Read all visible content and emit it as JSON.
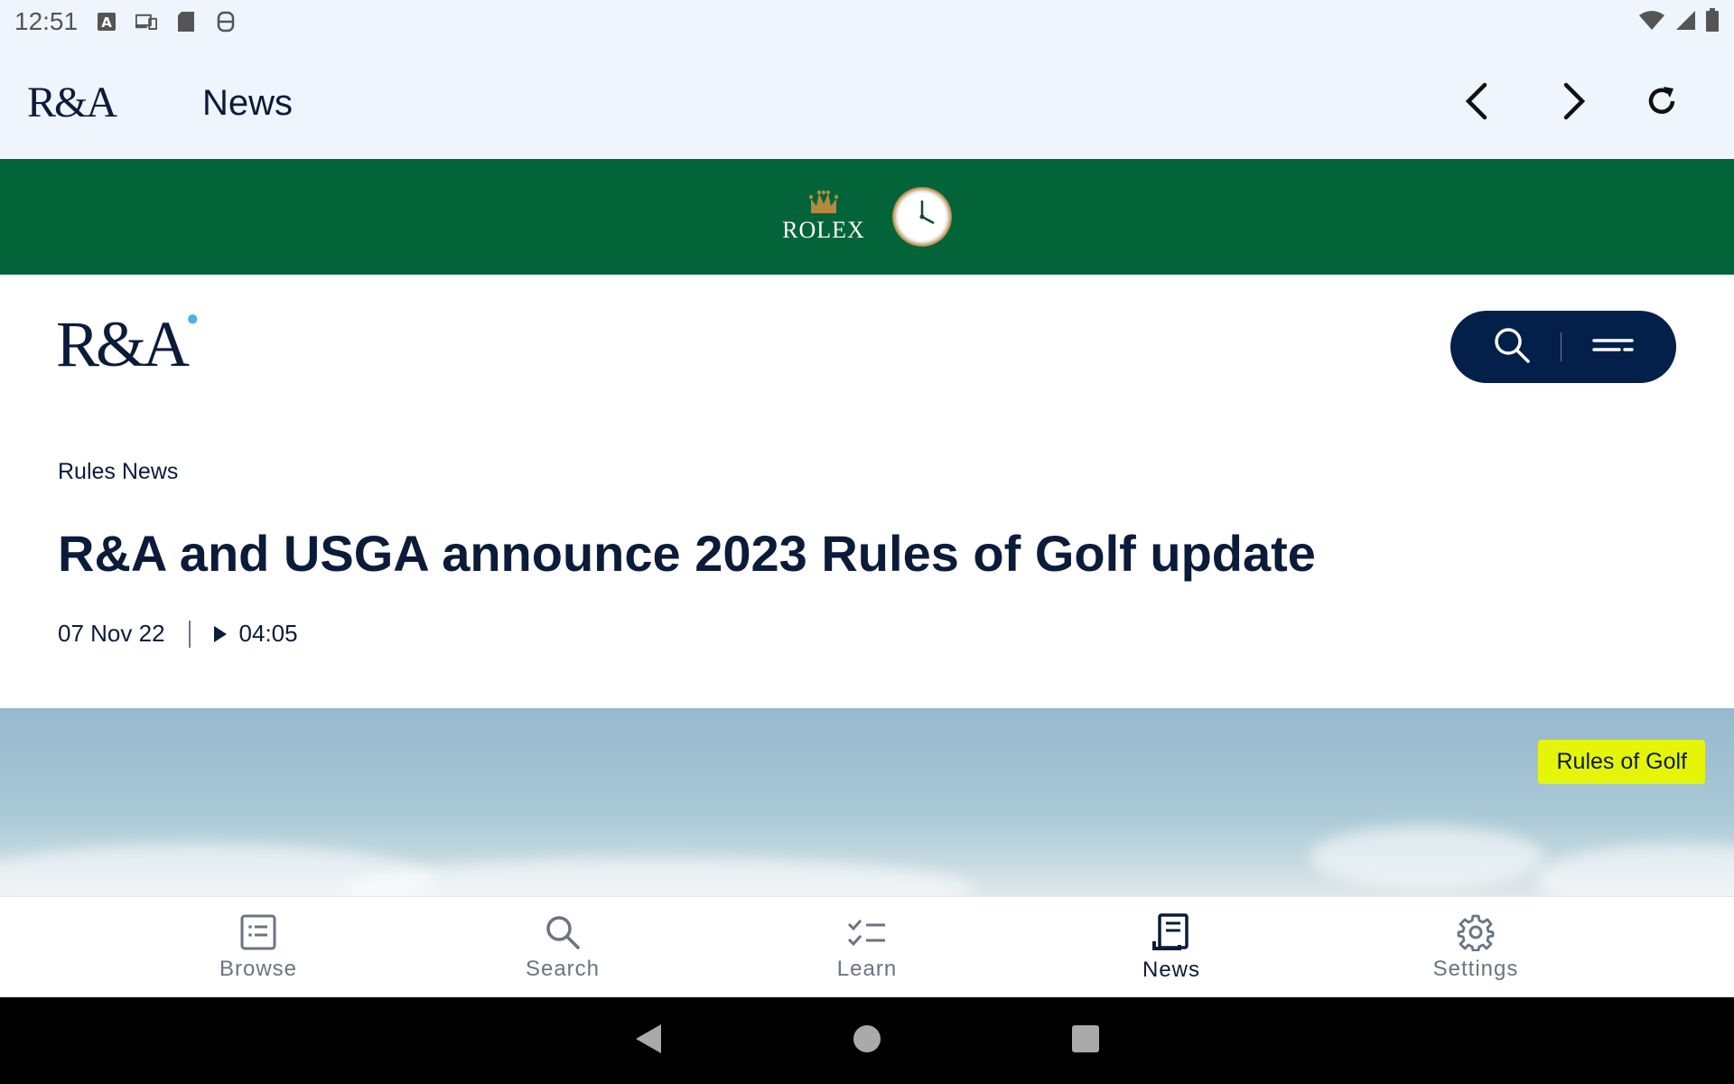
{
  "status_bar": {
    "time": "12:51"
  },
  "app_bar": {
    "logo": "R&A",
    "title": "News"
  },
  "sponsor": {
    "brand": "ROLEX"
  },
  "site": {
    "logo": "R&A"
  },
  "article": {
    "category": "Rules News",
    "headline": "R&A and USGA announce 2023 Rules of Golf update",
    "date": "07 Nov 22",
    "duration": "04:05",
    "image_tag": "Rules of Golf"
  },
  "bottom_nav": {
    "tabs": [
      {
        "label": "Browse",
        "icon": "browse-icon"
      },
      {
        "label": "Search",
        "icon": "search-icon"
      },
      {
        "label": "Learn",
        "icon": "checklist-icon"
      },
      {
        "label": "News",
        "icon": "news-icon",
        "active": true
      },
      {
        "label": "Settings",
        "icon": "gear-icon"
      }
    ]
  },
  "colors": {
    "navy": "#0b1b3a",
    "rolex_green": "#03643a",
    "tag_yellow": "#e5f50a",
    "app_bar_bg": "#eef5fd"
  }
}
